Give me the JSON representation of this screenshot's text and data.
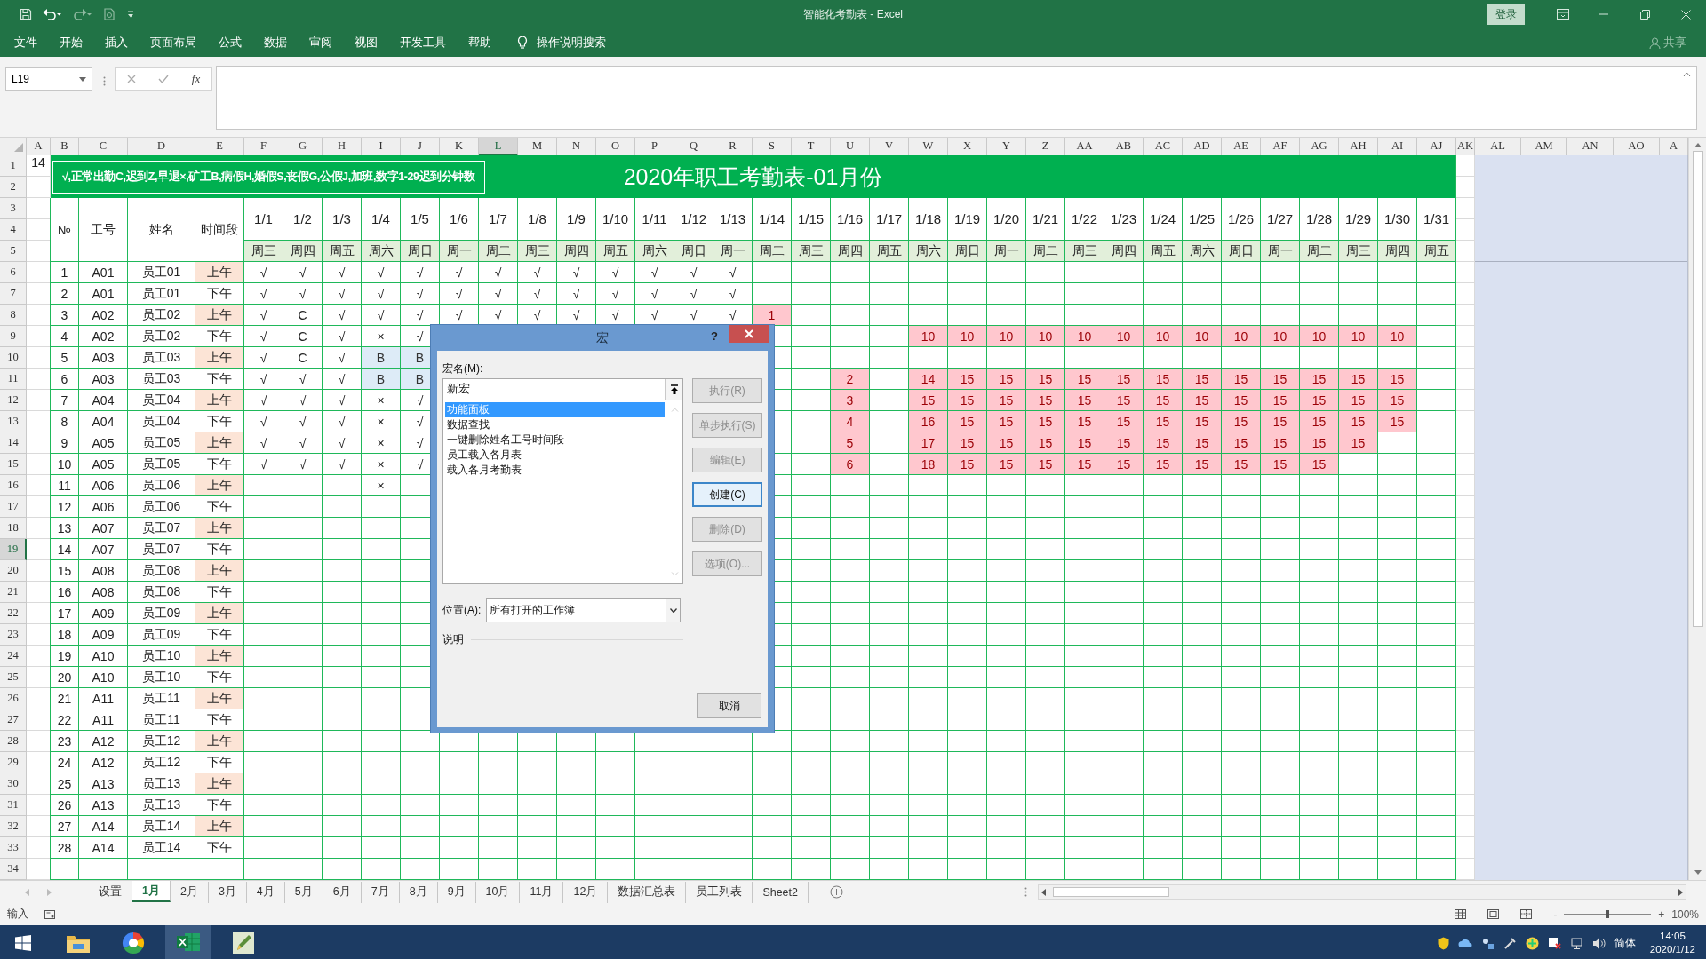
{
  "title_bar": {
    "title": "智能化考勤表 - Excel",
    "sign_in": "登录"
  },
  "menu": [
    "文件",
    "开始",
    "插入",
    "页面布局",
    "公式",
    "数据",
    "审阅",
    "视图",
    "开发工具",
    "帮助"
  ],
  "tell_me": "操作说明搜索",
  "share": "共享",
  "formula_bar": {
    "name_box": "L19",
    "function_button": "fx"
  },
  "sheet": {
    "columns": [
      {
        "label": "A",
        "selected": false
      },
      {
        "label": "B",
        "selected": false
      },
      {
        "label": "C",
        "selected": false
      },
      {
        "label": "D",
        "selected": false
      },
      {
        "label": "E",
        "selected": false
      },
      {
        "label": "F",
        "selected": false
      },
      {
        "label": "G",
        "selected": false
      },
      {
        "label": "H",
        "selected": false
      },
      {
        "label": "I",
        "selected": false
      },
      {
        "label": "J",
        "selected": false
      },
      {
        "label": "K",
        "selected": false
      },
      {
        "label": "L",
        "selected": true
      },
      {
        "label": "M",
        "selected": false
      },
      {
        "label": "N",
        "selected": false
      },
      {
        "label": "O",
        "selected": false
      },
      {
        "label": "P",
        "selected": false
      },
      {
        "label": "Q",
        "selected": false
      },
      {
        "label": "R",
        "selected": false
      },
      {
        "label": "S",
        "selected": false
      },
      {
        "label": "T",
        "selected": false
      },
      {
        "label": "U",
        "selected": false
      },
      {
        "label": "V",
        "selected": false
      },
      {
        "label": "W",
        "selected": false
      },
      {
        "label": "X",
        "selected": false
      },
      {
        "label": "Y",
        "selected": false
      },
      {
        "label": "Z",
        "selected": false
      },
      {
        "label": "AA",
        "selected": false
      },
      {
        "label": "AB",
        "selected": false
      },
      {
        "label": "AC",
        "selected": false
      },
      {
        "label": "AD",
        "selected": false
      },
      {
        "label": "AE",
        "selected": false
      },
      {
        "label": "AF",
        "selected": false
      },
      {
        "label": "AG",
        "selected": false
      },
      {
        "label": "AH",
        "selected": false
      },
      {
        "label": "AI",
        "selected": false
      },
      {
        "label": "AJ",
        "selected": false
      },
      {
        "label": "AK",
        "selected": false
      },
      {
        "label": "AL",
        "selected": false
      },
      {
        "label": "AM",
        "selected": false
      },
      {
        "label": "AN",
        "selected": false
      },
      {
        "label": "AO",
        "selected": false
      },
      {
        "label": "A",
        "selected": false
      }
    ],
    "rows": [
      {
        "label": "1",
        "selected": false
      },
      {
        "label": "2",
        "selected": false
      },
      {
        "label": "3",
        "selected": false
      },
      {
        "label": "4",
        "selected": false
      },
      {
        "label": "5",
        "selected": false
      },
      {
        "label": "6",
        "selected": false
      },
      {
        "label": "7",
        "selected": false
      },
      {
        "label": "8",
        "selected": false
      },
      {
        "label": "9",
        "selected": false
      },
      {
        "label": "10",
        "selected": false
      },
      {
        "label": "11",
        "selected": false
      },
      {
        "label": "12",
        "selected": false
      },
      {
        "label": "13",
        "selected": false
      },
      {
        "label": "14",
        "selected": false
      },
      {
        "label": "15",
        "selected": false
      },
      {
        "label": "16",
        "selected": false
      },
      {
        "label": "17",
        "selected": false
      },
      {
        "label": "18",
        "selected": false
      },
      {
        "label": "19",
        "selected": true
      },
      {
        "label": "20",
        "selected": false
      },
      {
        "label": "21",
        "selected": false
      },
      {
        "label": "22",
        "selected": false
      },
      {
        "label": "23",
        "selected": false
      },
      {
        "label": "24",
        "selected": false
      },
      {
        "label": "25",
        "selected": false
      },
      {
        "label": "26",
        "selected": false
      },
      {
        "label": "27",
        "selected": false
      },
      {
        "label": "28",
        "selected": false
      },
      {
        "label": "29",
        "selected": false
      },
      {
        "label": "30",
        "selected": false
      },
      {
        "label": "31",
        "selected": false
      },
      {
        "label": "32",
        "selected": false
      },
      {
        "label": "33",
        "selected": false
      },
      {
        "label": "34",
        "selected": false
      }
    ],
    "a1": "14",
    "legend": "√,正常出勤C,迟到Z,早退×,矿工B,病假H,婚假S,丧假G,公假J,加班,数字1-29迟到分钟数",
    "title": "2020年职工考勤表-01月份",
    "headers": [
      "№",
      "工号",
      "姓名",
      "时间段"
    ],
    "dates": [
      "1/1",
      "1/2",
      "1/3",
      "1/4",
      "1/5",
      "1/6",
      "1/7",
      "1/8",
      "1/9",
      "1/10",
      "1/11",
      "1/12",
      "1/13",
      "1/14",
      "1/15",
      "1/16",
      "1/17",
      "1/18",
      "1/19",
      "1/20",
      "1/21",
      "1/22",
      "1/23",
      "1/24",
      "1/25",
      "1/26",
      "1/27",
      "1/28",
      "1/29",
      "1/30",
      "1/31"
    ],
    "weekdays": [
      "周三",
      "周四",
      "周五",
      "周六",
      "周日",
      "周一",
      "周二",
      "周三",
      "周四",
      "周五",
      "周六",
      "周日",
      "周一",
      "周二",
      "周三",
      "周四",
      "周五",
      "周六",
      "周日",
      "周一",
      "周二",
      "周三",
      "周四",
      "周五",
      "周六",
      "周日",
      "周一",
      "周二",
      "周三",
      "周四",
      "周五"
    ],
    "records": [
      {
        "no": "1",
        "id": "A01",
        "name": "员工01",
        "period": "上午",
        "shaded": true,
        "days": [
          "√",
          "√",
          "√",
          "√",
          "√",
          "√",
          "√",
          "√",
          "√",
          "√",
          "√",
          "√",
          "√"
        ]
      },
      {
        "no": "2",
        "id": "A01",
        "name": "员工01",
        "period": "下午",
        "shaded": false,
        "days": [
          "√",
          "√",
          "√",
          "√",
          "√",
          "√",
          "√",
          "√",
          "√",
          "√",
          "√",
          "√",
          "√"
        ]
      },
      {
        "no": "3",
        "id": "A02",
        "name": "员工02",
        "period": "上午",
        "shaded": true,
        "days": [
          "√",
          "C",
          "√",
          "√",
          "√",
          "√",
          "√",
          "√",
          "√",
          "√",
          "√",
          "√",
          "√",
          {
            "kind": "value",
            "value": "1",
            "color": "#ffc7ce"
          }
        ]
      },
      {
        "no": "4",
        "id": "A02",
        "name": "员工02",
        "period": "下午",
        "shaded": false,
        "days": [
          "√",
          "C",
          "√",
          "×",
          "√",
          {
            "kind": "empty"
          },
          {
            "kind": "empty"
          },
          {
            "kind": "empty"
          },
          {
            "kind": "empty"
          },
          {
            "kind": "empty"
          },
          {
            "kind": "empty"
          },
          {
            "kind": "empty"
          },
          {
            "kind": "empty"
          },
          {
            "kind": "empty"
          },
          {
            "kind": "empty"
          },
          {
            "kind": "empty"
          },
          {
            "kind": "empty"
          },
          {
            "kind": "value",
            "value": "10",
            "color": "#ffc7ce"
          },
          {
            "kind": "value",
            "value": "10",
            "color": "#ffc7ce"
          },
          {
            "kind": "value",
            "value": "10",
            "color": "#ffc7ce"
          },
          {
            "kind": "value",
            "value": "10",
            "color": "#ffc7ce"
          },
          {
            "kind": "value",
            "value": "10",
            "color": "#ffc7ce"
          },
          {
            "kind": "value",
            "value": "10",
            "color": "#ffc7ce"
          },
          {
            "kind": "value",
            "value": "10",
            "color": "#ffc7ce"
          },
          {
            "kind": "value",
            "value": "10",
            "color": "#ffc7ce"
          },
          {
            "kind": "value",
            "value": "10",
            "color": "#ffc7ce"
          },
          {
            "kind": "value",
            "value": "10",
            "color": "#ffc7ce"
          },
          {
            "kind": "value",
            "value": "10",
            "color": "#ffc7ce"
          },
          {
            "kind": "value",
            "value": "10",
            "color": "#ffc7ce"
          },
          {
            "kind": "value",
            "value": "10",
            "color": "#ffc7ce"
          }
        ]
      },
      {
        "no": "5",
        "id": "A03",
        "name": "员工03",
        "period": "上午",
        "shaded": true,
        "days": [
          "√",
          "C",
          "√",
          {
            "kind": "value",
            "value": "B",
            "color": "#ddebf7"
          },
          {
            "kind": "value",
            "value": "B",
            "color": "#ddebf7"
          }
        ]
      },
      {
        "no": "6",
        "id": "A03",
        "name": "员工03",
        "period": "下午",
        "shaded": false,
        "days": [
          "√",
          "√",
          "√",
          {
            "kind": "value",
            "value": "B",
            "color": "#ddebf7"
          },
          {
            "kind": "value",
            "value": "B",
            "color": "#ddebf7"
          },
          {
            "kind": "empty"
          },
          {
            "kind": "empty"
          },
          {
            "kind": "empty"
          },
          {
            "kind": "empty"
          },
          {
            "kind": "empty"
          },
          {
            "kind": "empty"
          },
          {
            "kind": "empty"
          },
          {
            "kind": "empty"
          },
          {
            "kind": "empty"
          },
          {
            "kind": "empty"
          },
          {
            "kind": "value",
            "value": "2",
            "color": "#ffc7ce"
          },
          {
            "kind": "empty"
          },
          {
            "kind": "value",
            "value": "14",
            "color": "#ffc7ce"
          },
          {
            "kind": "value",
            "value": "15",
            "color": "#ffc7ce"
          },
          {
            "kind": "value",
            "value": "15",
            "color": "#ffc7ce"
          },
          {
            "kind": "value",
            "value": "15",
            "color": "#ffc7ce"
          },
          {
            "kind": "value",
            "value": "15",
            "color": "#ffc7ce"
          },
          {
            "kind": "value",
            "value": "15",
            "color": "#ffc7ce"
          },
          {
            "kind": "value",
            "value": "15",
            "color": "#ffc7ce"
          },
          {
            "kind": "value",
            "value": "15",
            "color": "#ffc7ce"
          },
          {
            "kind": "value",
            "value": "15",
            "color": "#ffc7ce"
          },
          {
            "kind": "value",
            "value": "15",
            "color": "#ffc7ce"
          },
          {
            "kind": "value",
            "value": "15",
            "color": "#ffc7ce"
          },
          {
            "kind": "value",
            "value": "15",
            "color": "#ffc7ce"
          },
          {
            "kind": "value",
            "value": "15",
            "color": "#ffc7ce"
          }
        ]
      },
      {
        "no": "7",
        "id": "A04",
        "name": "员工04",
        "period": "上午",
        "shaded": true,
        "days": [
          "√",
          "√",
          "√",
          "×",
          "√",
          {
            "kind": "empty"
          },
          {
            "kind": "empty"
          },
          {
            "kind": "empty"
          },
          {
            "kind": "empty"
          },
          {
            "kind": "empty"
          },
          {
            "kind": "empty"
          },
          {
            "kind": "empty"
          },
          {
            "kind": "empty"
          },
          {
            "kind": "empty"
          },
          {
            "kind": "empty"
          },
          {
            "kind": "value",
            "value": "3",
            "color": "#ffc7ce"
          },
          {
            "kind": "empty"
          },
          {
            "kind": "value",
            "value": "15",
            "color": "#ffc7ce"
          },
          {
            "kind": "value",
            "value": "15",
            "color": "#ffc7ce"
          },
          {
            "kind": "value",
            "value": "15",
            "color": "#ffc7ce"
          },
          {
            "kind": "value",
            "value": "15",
            "color": "#ffc7ce"
          },
          {
            "kind": "value",
            "value": "15",
            "color": "#ffc7ce"
          },
          {
            "kind": "value",
            "value": "15",
            "color": "#ffc7ce"
          },
          {
            "kind": "value",
            "value": "15",
            "color": "#ffc7ce"
          },
          {
            "kind": "value",
            "value": "15",
            "color": "#ffc7ce"
          },
          {
            "kind": "value",
            "value": "15",
            "color": "#ffc7ce"
          },
          {
            "kind": "value",
            "value": "15",
            "color": "#ffc7ce"
          },
          {
            "kind": "value",
            "value": "15",
            "color": "#ffc7ce"
          },
          {
            "kind": "value",
            "value": "15",
            "color": "#ffc7ce"
          },
          {
            "kind": "value",
            "value": "15",
            "color": "#ffc7ce"
          }
        ]
      },
      {
        "no": "8",
        "id": "A04",
        "name": "员工04",
        "period": "下午",
        "shaded": false,
        "days": [
          "√",
          "√",
          "√",
          "×",
          "√",
          {
            "kind": "empty"
          },
          {
            "kind": "empty"
          },
          {
            "kind": "empty"
          },
          {
            "kind": "empty"
          },
          {
            "kind": "empty"
          },
          {
            "kind": "empty"
          },
          {
            "kind": "empty"
          },
          {
            "kind": "empty"
          },
          {
            "kind": "empty"
          },
          {
            "kind": "empty"
          },
          {
            "kind": "value",
            "value": "4",
            "color": "#ffc7ce"
          },
          {
            "kind": "empty"
          },
          {
            "kind": "value",
            "value": "16",
            "color": "#ffc7ce"
          },
          {
            "kind": "value",
            "value": "15",
            "color": "#ffc7ce"
          },
          {
            "kind": "value",
            "value": "15",
            "color": "#ffc7ce"
          },
          {
            "kind": "value",
            "value": "15",
            "color": "#ffc7ce"
          },
          {
            "kind": "value",
            "value": "15",
            "color": "#ffc7ce"
          },
          {
            "kind": "value",
            "value": "15",
            "color": "#ffc7ce"
          },
          {
            "kind": "value",
            "value": "15",
            "color": "#ffc7ce"
          },
          {
            "kind": "value",
            "value": "15",
            "color": "#ffc7ce"
          },
          {
            "kind": "value",
            "value": "15",
            "color": "#ffc7ce"
          },
          {
            "kind": "value",
            "value": "15",
            "color": "#ffc7ce"
          },
          {
            "kind": "value",
            "value": "15",
            "color": "#ffc7ce"
          },
          {
            "kind": "value",
            "value": "15",
            "color": "#ffc7ce"
          },
          {
            "kind": "value",
            "value": "15",
            "color": "#ffc7ce"
          }
        ]
      },
      {
        "no": "9",
        "id": "A05",
        "name": "员工05",
        "period": "上午",
        "shaded": true,
        "days": [
          "√",
          "√",
          "√",
          "×",
          "√",
          {
            "kind": "empty"
          },
          {
            "kind": "empty"
          },
          {
            "kind": "empty"
          },
          {
            "kind": "empty"
          },
          {
            "kind": "empty"
          },
          {
            "kind": "empty"
          },
          {
            "kind": "empty"
          },
          {
            "kind": "empty"
          },
          {
            "kind": "empty"
          },
          {
            "kind": "empty"
          },
          {
            "kind": "value",
            "value": "5",
            "color": "#ffc7ce"
          },
          {
            "kind": "empty"
          },
          {
            "kind": "value",
            "value": "17",
            "color": "#ffc7ce"
          },
          {
            "kind": "value",
            "value": "15",
            "color": "#ffc7ce"
          },
          {
            "kind": "value",
            "value": "15",
            "color": "#ffc7ce"
          },
          {
            "kind": "value",
            "value": "15",
            "color": "#ffc7ce"
          },
          {
            "kind": "value",
            "value": "15",
            "color": "#ffc7ce"
          },
          {
            "kind": "value",
            "value": "15",
            "color": "#ffc7ce"
          },
          {
            "kind": "value",
            "value": "15",
            "color": "#ffc7ce"
          },
          {
            "kind": "value",
            "value": "15",
            "color": "#ffc7ce"
          },
          {
            "kind": "value",
            "value": "15",
            "color": "#ffc7ce"
          },
          {
            "kind": "value",
            "value": "15",
            "color": "#ffc7ce"
          },
          {
            "kind": "value",
            "value": "15",
            "color": "#ffc7ce"
          },
          {
            "kind": "value",
            "value": "15",
            "color": "#ffc7ce"
          }
        ]
      },
      {
        "no": "10",
        "id": "A05",
        "name": "员工05",
        "period": "下午",
        "shaded": false,
        "days": [
          "√",
          "√",
          "√",
          "×",
          "√",
          {
            "kind": "empty"
          },
          {
            "kind": "empty"
          },
          {
            "kind": "empty"
          },
          {
            "kind": "empty"
          },
          {
            "kind": "empty"
          },
          {
            "kind": "empty"
          },
          {
            "kind": "empty"
          },
          {
            "kind": "empty"
          },
          {
            "kind": "empty"
          },
          {
            "kind": "empty"
          },
          {
            "kind": "value",
            "value": "6",
            "color": "#ffc7ce"
          },
          {
            "kind": "empty"
          },
          {
            "kind": "value",
            "value": "18",
            "color": "#ffc7ce"
          },
          {
            "kind": "value",
            "value": "15",
            "color": "#ffc7ce"
          },
          {
            "kind": "value",
            "value": "15",
            "color": "#ffc7ce"
          },
          {
            "kind": "value",
            "value": "15",
            "color": "#ffc7ce"
          },
          {
            "kind": "value",
            "value": "15",
            "color": "#ffc7ce"
          },
          {
            "kind": "value",
            "value": "15",
            "color": "#ffc7ce"
          },
          {
            "kind": "value",
            "value": "15",
            "color": "#ffc7ce"
          },
          {
            "kind": "value",
            "value": "15",
            "color": "#ffc7ce"
          },
          {
            "kind": "value",
            "value": "15",
            "color": "#ffc7ce"
          },
          {
            "kind": "value",
            "value": "15",
            "color": "#ffc7ce"
          },
          {
            "kind": "value",
            "value": "15",
            "color": "#ffc7ce"
          }
        ]
      },
      {
        "no": "11",
        "id": "A06",
        "name": "员工06",
        "period": "上午",
        "shaded": true,
        "days": [
          {
            "kind": "empty"
          },
          {
            "kind": "empty"
          },
          {
            "kind": "empty"
          },
          "×"
        ]
      },
      {
        "no": "12",
        "id": "A06",
        "name": "员工06",
        "period": "下午",
        "shaded": false
      },
      {
        "no": "13",
        "id": "A07",
        "name": "员工07",
        "period": "上午",
        "shaded": true
      },
      {
        "no": "14",
        "id": "A07",
        "name": "员工07",
        "period": "下午",
        "shaded": false
      },
      {
        "no": "15",
        "id": "A08",
        "name": "员工08",
        "period": "上午",
        "shaded": true
      },
      {
        "no": "16",
        "id": "A08",
        "name": "员工08",
        "period": "下午",
        "shaded": false
      },
      {
        "no": "17",
        "id": "A09",
        "name": "员工09",
        "period": "上午",
        "shaded": true
      },
      {
        "no": "18",
        "id": "A09",
        "name": "员工09",
        "period": "下午",
        "shaded": false
      },
      {
        "no": "19",
        "id": "A10",
        "name": "员工10",
        "period": "上午",
        "shaded": true
      },
      {
        "no": "20",
        "id": "A10",
        "name": "员工10",
        "period": "下午",
        "shaded": false
      },
      {
        "no": "21",
        "id": "A11",
        "name": "员工11",
        "period": "上午",
        "shaded": true
      },
      {
        "no": "22",
        "id": "A11",
        "name": "员工11",
        "period": "下午",
        "shaded": false
      },
      {
        "no": "23",
        "id": "A12",
        "name": "员工12",
        "period": "上午",
        "shaded": true
      },
      {
        "no": "24",
        "id": "A12",
        "name": "员工12",
        "period": "下午",
        "shaded": false
      },
      {
        "no": "25",
        "id": "A13",
        "name": "员工13",
        "period": "上午",
        "shaded": true
      },
      {
        "no": "26",
        "id": "A13",
        "name": "员工13",
        "period": "下午",
        "shaded": false
      },
      {
        "no": "27",
        "id": "A14",
        "name": "员工14",
        "period": "上午",
        "shaded": true
      },
      {
        "no": "28",
        "id": "A14",
        "name": "员工14",
        "period": "下午",
        "shaded": false
      }
    ]
  },
  "sheet_tabs": [
    {
      "label": "设置",
      "selected": false
    },
    {
      "label": "1月",
      "selected": true
    },
    {
      "label": "2月",
      "selected": false
    },
    {
      "label": "3月",
      "selected": false
    },
    {
      "label": "4月",
      "selected": false
    },
    {
      "label": "5月",
      "selected": false
    },
    {
      "label": "6月",
      "selected": false
    },
    {
      "label": "7月",
      "selected": false
    },
    {
      "label": "8月",
      "selected": false
    },
    {
      "label": "9月",
      "selected": false
    },
    {
      "label": "10月",
      "selected": false
    },
    {
      "label": "11月",
      "selected": false
    },
    {
      "label": "12月",
      "selected": false
    },
    {
      "label": "数据汇总表",
      "selected": false
    },
    {
      "label": "员工列表",
      "selected": false
    },
    {
      "label": "Sheet2",
      "selected": false
    }
  ],
  "status_bar": {
    "mode": "输入",
    "zoom_out": "-",
    "zoom_in": "+",
    "zoom": {
      "level": 0.5,
      "reading": "100%"
    }
  },
  "macro_dialog": {
    "title": "宏",
    "help": "?",
    "name_label": "宏名(M):",
    "name_value": "新宏",
    "macros": [
      {
        "label": "功能面板",
        "selected": true
      },
      {
        "label": "数据查找",
        "selected": false
      },
      {
        "label": "一键删除姓名工号时间段",
        "selected": false
      },
      {
        "label": "员工载入各月表",
        "selected": false
      },
      {
        "label": "载入各月考勤表",
        "selected": false
      }
    ],
    "buttons": [
      {
        "label": "执行(R)",
        "disabled": true,
        "focused": false
      },
      {
        "label": "单步执行(S)",
        "disabled": true,
        "focused": false
      },
      {
        "label": "编辑(E)",
        "disabled": true,
        "focused": false
      },
      {
        "label": "创建(C)",
        "disabled": false,
        "focused": true
      },
      {
        "label": "删除(D)",
        "disabled": true,
        "focused": false
      },
      {
        "label": "选项(O)...",
        "disabled": true,
        "focused": false
      }
    ],
    "location_label": "位置(A):",
    "location_value": "所有打开的工作簿",
    "description_label": "说明",
    "cancel": "取消"
  },
  "taskbar": {
    "input_method": "简体",
    "time": "14:05",
    "date": "2020/1/12"
  }
}
